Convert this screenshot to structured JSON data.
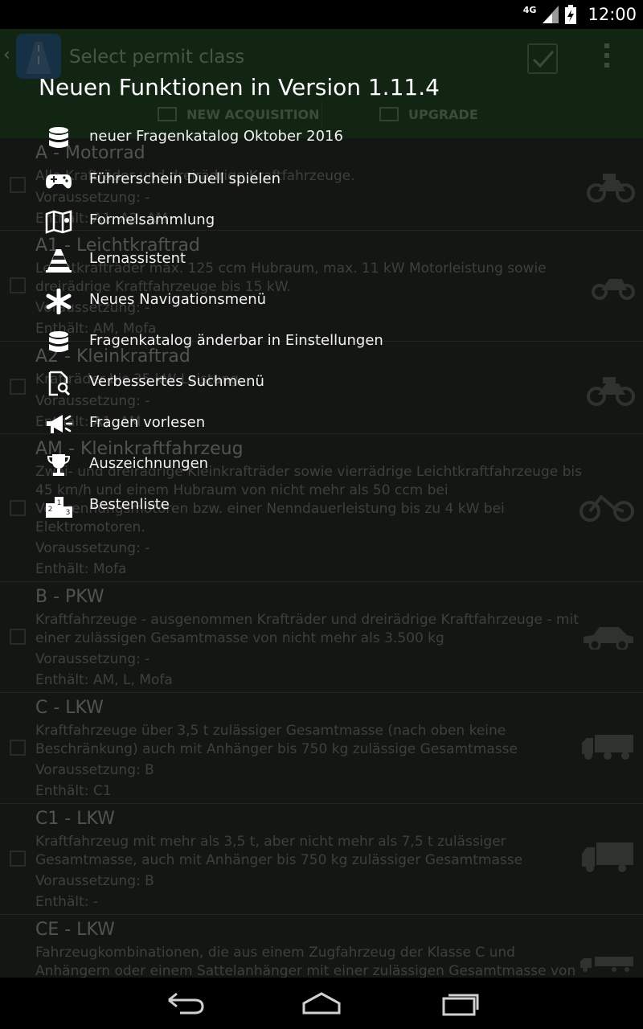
{
  "status_bar": {
    "network": "4G",
    "time": "12:00"
  },
  "action_bar": {
    "title": "Select permit class",
    "tabs": [
      {
        "label": "NEW ACQUISITION"
      },
      {
        "label": "UPGRADE"
      }
    ]
  },
  "permit_classes": [
    {
      "title": "A - Motorrad",
      "description": "Alle Krafträder und dreirädrige Kraftfahrzeuge.",
      "requirement": "Voraussetzung: -",
      "includes": "Enthält: A1, A2, AM",
      "vehicle": "motorcycle"
    },
    {
      "title": "A1 - Leichtkraftrad",
      "description": "Leichtkrafträder max. 125 ccm Hubraum, max. 11 kW Motorleistung sowie dreirädrige Kraftfahrzeuge bis 15 kW.",
      "requirement": "Voraussetzung: -",
      "includes": "Enthält: AM, Mofa",
      "vehicle": "light-motorcycle"
    },
    {
      "title": "A2 - Kleinkraftrad",
      "description": "Krafträder bis 35 kW Leistung.",
      "requirement": "Voraussetzung: -",
      "includes": "Enthält: A1, AM",
      "vehicle": "motorcycle"
    },
    {
      "title": "AM - Kleinkraftfahrzeug",
      "description": "Zwei- und dreirädrige Kleinkrafträder sowie vierrädrige Leichtkraftfahrzeuge bis 45 km/h und einem Hubraum von nicht mehr als 50 ccm bei Verbrennungsmotoren bzw. einer Nenndauerleistung bis zu 4 kW bei Elektromotoren.",
      "requirement": "Voraussetzung: -",
      "includes": "Enthält: Mofa",
      "vehicle": "moped"
    },
    {
      "title": "B - PKW",
      "description": "Kraftfahrzeuge - ausgenommen Krafträder und dreirädrige Kraftfahrzeuge - mit einer zulässigen Gesamtmasse von nicht mehr als 3.500 kg",
      "requirement": "Voraussetzung: -",
      "includes": "Enthält: AM, L, Mofa",
      "vehicle": "car"
    },
    {
      "title": "C - LKW",
      "description": "Kraftfahrzeuge über 3,5 t zulässiger Gesamtmasse (nach oben keine Beschränkung) auch mit Anhänger bis 750 kg zulässige Gesamtmasse",
      "requirement": "Voraussetzung: B",
      "includes": "Enthält: C1",
      "vehicle": "truck"
    },
    {
      "title": "C1 - LKW",
      "description": "Kraftfahrzeug mit mehr als 3,5 t, aber nicht mehr als 7,5 t zulässiger Gesamtmasse, auch mit Anhänger bis 750 kg zulässiger Gesamtmasse",
      "requirement": "Voraussetzung: B",
      "includes": "Enthält: -",
      "vehicle": "small-truck"
    },
    {
      "title": "CE - LKW",
      "description": "Fahrzeugkombinationen, die aus einem Zugfahrzeug der Klasse C und Anhängern oder einem Sattelanhänger mit einer zulässigen Gesamtmasse von",
      "requirement": "",
      "includes": "",
      "vehicle": "semi-truck"
    }
  ],
  "whats_new": {
    "title": "Neuen Funktionen in Version 1.11.4",
    "features": [
      {
        "label": "neuer Fragenkatalog Oktober 2016",
        "icon": "database-icon"
      },
      {
        "label": "Führerschein Duell spielen",
        "icon": "gamepad-icon"
      },
      {
        "label": "Formelsammlung",
        "icon": "map-book-icon"
      },
      {
        "label": "Lernassistent",
        "icon": "traffic-cone-icon"
      },
      {
        "label": "Neues Navigationsmenü",
        "icon": "asterisk-icon"
      },
      {
        "label": "Fragenkatalog änderbar in Einstellungen",
        "icon": "database-icon"
      },
      {
        "label": "Verbessertes Suchmenü",
        "icon": "document-search-icon"
      },
      {
        "label": "Fragen vorlesen",
        "icon": "megaphone-icon"
      },
      {
        "label": "Auszeichnungen",
        "icon": "trophy-icon"
      },
      {
        "label": "Bestenliste",
        "icon": "podium-icon"
      }
    ]
  },
  "colors": {
    "action_bar": "#1c3a1c",
    "background": "#1f221e",
    "overlay_text": "#ffffff"
  }
}
